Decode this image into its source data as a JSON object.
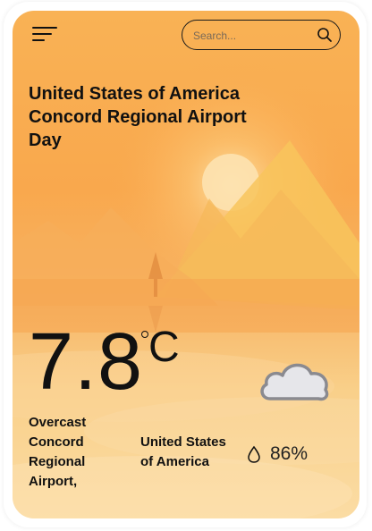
{
  "search": {
    "placeholder": "Search..."
  },
  "location": {
    "country": "United States of America",
    "airport": "Concord Regional Airport",
    "period": "Day"
  },
  "weather": {
    "temperature": "7.8",
    "unit": "C",
    "condition": "Overcast",
    "location_lines": [
      "Concord",
      "Regional",
      "Airport,"
    ],
    "country_lines": [
      "United States",
      "of America"
    ],
    "humidity": "86%"
  },
  "icons": [
    "menu-icon",
    "search-icon",
    "cloud-icon",
    "droplet-icon"
  ],
  "colors": {
    "card_top": "#f9b255",
    "card_bottom": "#fbdca4",
    "text": "#111111"
  }
}
